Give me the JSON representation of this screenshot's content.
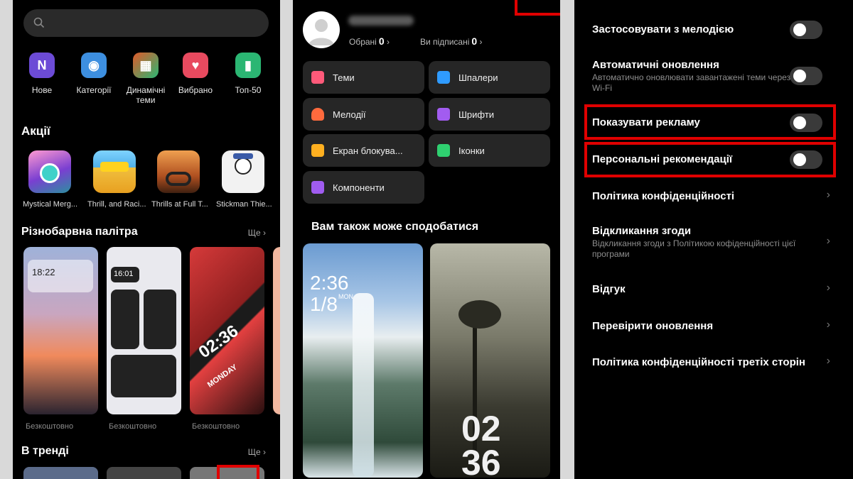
{
  "left_screen": {
    "categories": [
      {
        "label": "Нове",
        "icon": "new-icon",
        "glyph": "N",
        "color": "#6c4bd6"
      },
      {
        "label": "Категорії",
        "icon": "categories-icon",
        "glyph": "◉",
        "color": "#3d8fe0"
      },
      {
        "label": "Динамічні теми",
        "icon": "dynamic-themes-icon",
        "glyph": "▦",
        "color": "#e05a2a"
      },
      {
        "label": "Вибрано",
        "icon": "heart-icon",
        "glyph": "♥",
        "color": "#e84a5f"
      },
      {
        "label": "Топ-50",
        "icon": "top50-icon",
        "glyph": "▮",
        "color": "#2bb673"
      }
    ],
    "promos_title": "Акції",
    "apps": [
      {
        "name": "Mystical Merg..."
      },
      {
        "name": "Thrill, and Raci..."
      },
      {
        "name": "Thrills at Full T..."
      },
      {
        "name": "Stickman Thie..."
      }
    ],
    "palette_title": "Різнобарвна палітра",
    "palette_more": "Ще ›",
    "palette_items": [
      {
        "price": "Безкоштовно",
        "time": "18:22"
      },
      {
        "price": "Безкоштовно",
        "time": "16:01"
      },
      {
        "price": "Безкоштовно",
        "time": "02:36",
        "day": "MONDAY"
      }
    ],
    "trending_title": "В тренді",
    "trending_more": "Ще ›"
  },
  "middle_screen": {
    "favorites_label": "Обрані",
    "favorites_count": "0",
    "following_label": "Ви підписані",
    "following_count": "0",
    "tiles": [
      {
        "label": "Теми",
        "icon": "themes-icon",
        "color": "#ff5a7a"
      },
      {
        "label": "Шпалери",
        "icon": "wallpapers-icon",
        "color": "#2f9bff"
      },
      {
        "label": "Мелодії",
        "icon": "ringtones-icon",
        "color": "#ff6a3d"
      },
      {
        "label": "Шрифти",
        "icon": "fonts-icon",
        "color": "#a25cf0"
      },
      {
        "label": "Екран блокува...",
        "icon": "lockscreen-icon",
        "color": "#ffb020"
      },
      {
        "label": "Іконки",
        "icon": "icons-icon",
        "color": "#2fd070"
      },
      {
        "label": "Компоненти",
        "icon": "widgets-icon",
        "color": "#a05cf0"
      }
    ],
    "recommend_title": "Вам також може сподобатися",
    "wallpaper1_time": "2:36",
    "wallpaper1_date": "1/8",
    "wallpaper1_day": "MON",
    "wallpaper2_time_top": "02",
    "wallpaper2_time_bottom": "36"
  },
  "right_screen": {
    "rows": [
      {
        "title": "Застосовувати з мелодією",
        "type": "toggle"
      },
      {
        "title": "Автоматичні оновлення",
        "subtitle": "Автоматично оновлювати завантажені теми через Wi-Fi",
        "type": "toggle"
      },
      {
        "title": "Показувати рекламу",
        "type": "toggle"
      },
      {
        "title": "Персональні рекомендації",
        "type": "toggle"
      },
      {
        "title": "Політика конфіденційності",
        "type": "link"
      },
      {
        "title": "Відкликання згоди",
        "subtitle": "Відкликання згоди з Політикою кофіденційності цієї програми",
        "type": "link"
      },
      {
        "title": "Відгук",
        "type": "link"
      },
      {
        "title": "Перевірити оновлення",
        "type": "link"
      },
      {
        "title": "Політика конфіденційності третіх сторін",
        "type": "link"
      }
    ],
    "chevron": "›"
  },
  "colors": {
    "highlight": "#e00000",
    "tile_bg": "#262626",
    "toggle_off": "#3a3a3a"
  }
}
